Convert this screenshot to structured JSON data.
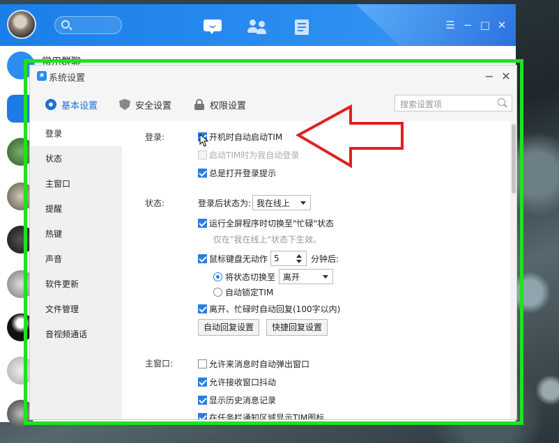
{
  "tim": {
    "partial_label": "常用群聊",
    "window_controls": [
      "☰",
      "−",
      "□",
      "✕"
    ]
  },
  "dialog": {
    "title": "系统设置",
    "tabs": [
      {
        "label": "基本设置",
        "icon": "gear-icon",
        "active": true
      },
      {
        "label": "安全设置",
        "icon": "shield-icon",
        "active": false
      },
      {
        "label": "权限设置",
        "icon": "lock-icon",
        "active": false
      }
    ],
    "search_placeholder": "搜索设置项",
    "nav": [
      "登录",
      "状态",
      "主窗口",
      "提醒",
      "热键",
      "声音",
      "软件更新",
      "文件管理",
      "音视频通话"
    ],
    "login": {
      "label": "登录:",
      "auto_start": "开机时自动启动TIM",
      "auto_login": "启动TIM时为我自动登录",
      "show_login_tip": "总是打开登录提示"
    },
    "status": {
      "label": "状态:",
      "after_login_label": "登录后状态为:",
      "after_login_value": "我在线上",
      "fullscreen_busy": "运行全屏程序时切换至\"忙碌\"状态",
      "fullscreen_hint": "仅在\"我在线上\"状态下生效。",
      "idle_prefix": "鼠标键盘无动作",
      "idle_minutes": "5",
      "idle_suffix": "分钟后:",
      "switch_label": "将状态切换至",
      "switch_value": "离开",
      "lock_label": "自动锁定TIM",
      "auto_reply": "离开、忙碌时自动回复(100字以内)",
      "auto_reply_btn": "自动回复设置",
      "quick_reply_btn": "快捷回复设置"
    },
    "main_window": {
      "label": "主窗口:",
      "popup_on_msg": "允许来消息时自动弹出窗口",
      "allow_shake": "允许接收窗口抖动",
      "show_history": "显示历史消息记录",
      "tray_icon": "在任务栏通知区域显示TIM图标"
    }
  },
  "colors": {
    "accent": "#2a7ee3",
    "annotation_red": "#e02020",
    "annotation_green": "#1fe21f"
  }
}
